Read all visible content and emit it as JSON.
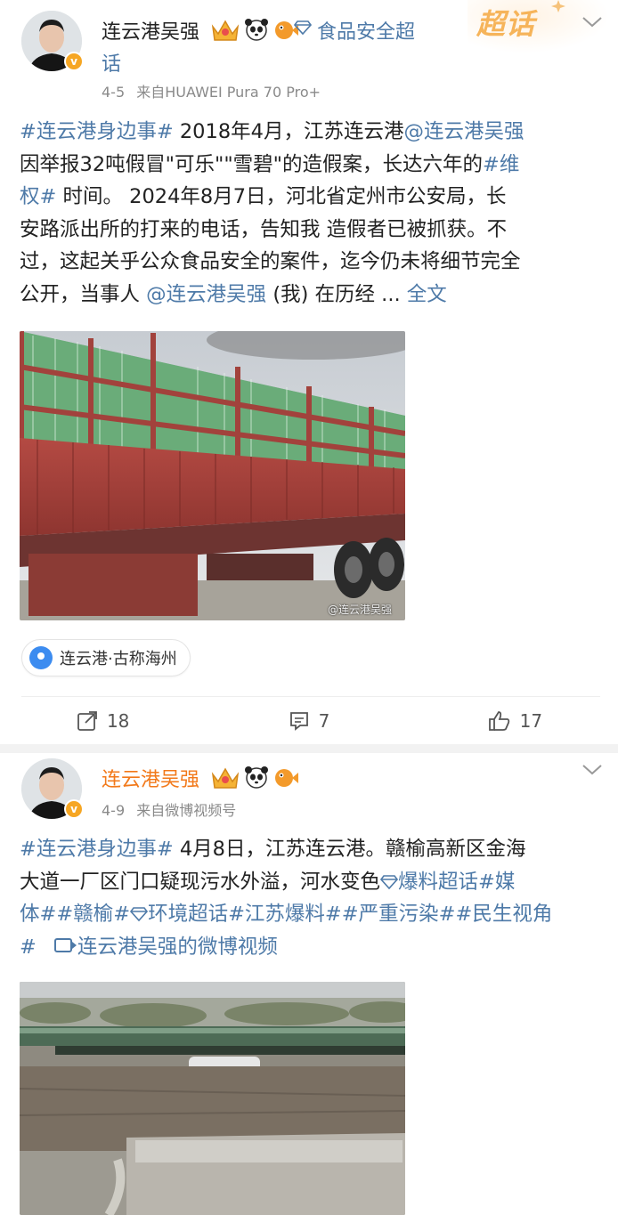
{
  "colors": {
    "link": "#4e7aa8",
    "username_highlight": "#f2791a",
    "meta": "#8a8a8a",
    "chaohua": "#f6b45a"
  },
  "post1": {
    "username": "连云港吴强",
    "badges": [
      "crown-icon",
      "panda-icon",
      "pufferfish-icon"
    ],
    "topic_label": "食品安全超",
    "topic_label_wrap": "话",
    "chaohua_banner": "超话",
    "date": "4-5",
    "source_prefix": "来自",
    "source": "HUAWEI Pura 70 Pro+",
    "text_lines": [
      [
        {
          "t": "#连云港身边事#",
          "link": true
        },
        {
          "t": " 2018年4月，江苏连云港",
          "link": false
        },
        {
          "t": "@连云港吴强",
          "link": true
        }
      ],
      [
        {
          "t": "因举报32吨假冒\"可乐\"\"雪碧\"的造假案，长达六年的",
          "link": false
        },
        {
          "t": "#维",
          "link": true
        }
      ],
      [
        {
          "t": "权#",
          "link": true
        },
        {
          "t": " 时间。 2024年8月7日，河北省定州市公安局，长",
          "link": false
        }
      ],
      [
        {
          "t": "安路派出所的打来的电话，告知我 造假者已被抓获。不",
          "link": false
        }
      ],
      [
        {
          "t": "过，这起关乎公众食品安全的案件，迄今仍未将细节完全",
          "link": false
        }
      ],
      [
        {
          "t": "公开，当事人 ",
          "link": false
        },
        {
          "t": "@连云港吴强",
          "link": true
        },
        {
          "t": " (我) 在历经 ... ",
          "link": false
        },
        {
          "t": "全文",
          "link": true
        }
      ]
    ],
    "watermark": "@连云港吴强",
    "location": "连云港·古称海州",
    "shares": "18",
    "comments": "7",
    "likes": "17"
  },
  "post2": {
    "username": "连云港吴强",
    "badges": [
      "crown-icon",
      "panda-icon",
      "pufferfish-icon"
    ],
    "date": "4-9",
    "source_prefix": "来自",
    "source": "微博视频号",
    "text_lines": [
      [
        {
          "t": "#连云港身边事#",
          "link": true
        },
        {
          "t": " 4月8日，江苏连云港。赣榆高新区金海",
          "link": false
        }
      ],
      [
        {
          "t": "大道一厂区门口疑现污水外溢，河水变色",
          "link": false
        },
        {
          "t": "爆料超话",
          "link": true,
          "icon": true
        },
        {
          "t": "#媒",
          "link": true
        }
      ],
      [
        {
          "t": "体##赣榆#",
          "link": true
        },
        {
          "t": "环境超话",
          "link": true,
          "icon": true
        },
        {
          "t": "#江苏爆料##严重污染##民生视角",
          "link": true
        }
      ],
      [
        {
          "t": "#",
          "link": true
        },
        {
          "t": "连云港吴强的微博视频",
          "link": true,
          "video": true
        }
      ]
    ]
  }
}
